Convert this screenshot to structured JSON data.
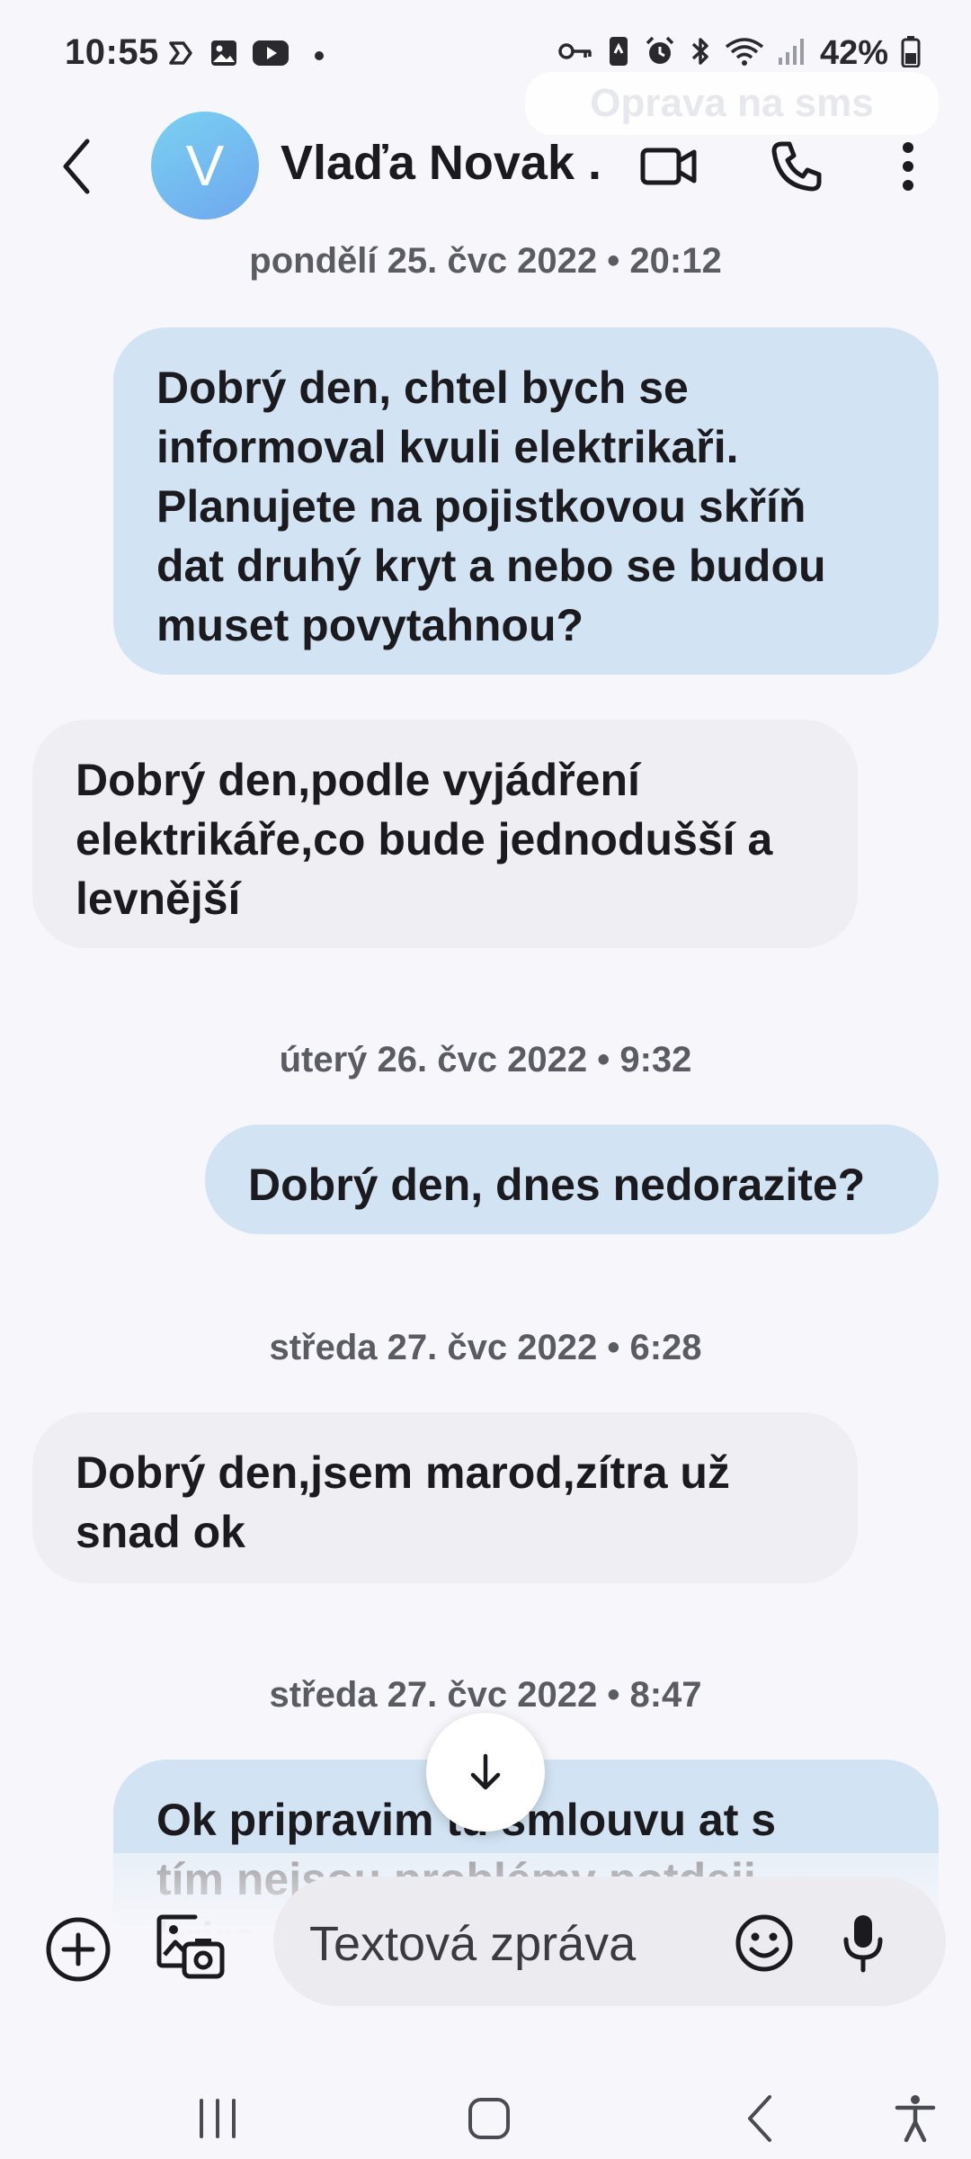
{
  "status_bar": {
    "time": "10:55",
    "battery": "42%",
    "left_icons": [
      "assistant-icon",
      "gallery-icon",
      "youtube-icon",
      "dot-icon"
    ],
    "right_icons": [
      "key-icon",
      "nfc-icon",
      "alarm-icon",
      "bluetooth-icon",
      "wifi-icon",
      "signal-icon",
      "battery-icon"
    ]
  },
  "toast": {
    "text": "Oprava na sms"
  },
  "app_bar": {
    "avatar_letter": "V",
    "contact_name": "Vlaďa Novak ...",
    "avatar_color": "#6fb7f0"
  },
  "messages": [
    {
      "type": "date",
      "text": "pondělí 25. čvc 2022 • 20:12"
    },
    {
      "type": "sent",
      "text": "Dobrý den,  chtel bych se\ninformoval kvuli elektrikaři.\nPlanujete na pojistkovou skříň\ndat druhý kryt a nebo se budou\nmuset povytahnou?"
    },
    {
      "type": "received",
      "text": "Dobrý den,podle vyjádření\nelektrikáře,co bude jednodušší a\nlevnější"
    },
    {
      "type": "date",
      "text": "úterý 26. čvc 2022 • 9:32"
    },
    {
      "type": "sent",
      "text": "Dobrý den,  dnes nedorazite?"
    },
    {
      "type": "date",
      "text": "středa 27. čvc 2022 • 6:28"
    },
    {
      "type": "received",
      "text": "Dobrý den,jsem marod,zítra už\nsnad ok"
    },
    {
      "type": "date",
      "text": "středa 27. čvc 2022 • 8:47"
    },
    {
      "type": "sent",
      "text": "Ok pripravim tu smlouvu at s\ntím nejsou problémy potdeji\nbrira"
    }
  ],
  "composer": {
    "placeholder": "Textová zpráva"
  },
  "colors": {
    "sent_bubble": "#d2e4f4",
    "received_bubble": "#efeff3",
    "background": "#f7f7fb"
  }
}
